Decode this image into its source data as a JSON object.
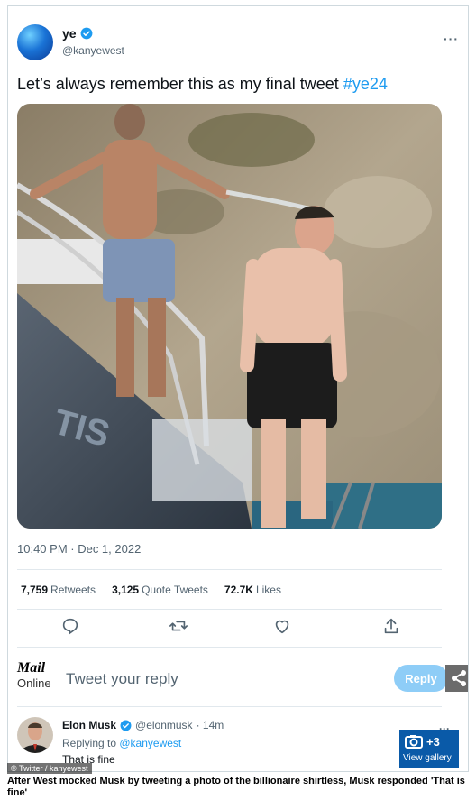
{
  "tweet": {
    "display_name": "ye",
    "handle": "@kanyewest",
    "text_main": "Let’s always remember this as my final tweet ",
    "hashtag": "#ye24",
    "timestamp": "10:40 PM · Dec 1, 2022",
    "more_icon": "more-dots-icon"
  },
  "stats": {
    "retweets_count": "7,759",
    "retweets_label": "Retweets",
    "quotes_count": "3,125",
    "quotes_label": "Quote Tweets",
    "likes_count": "72.7K",
    "likes_label": "Likes"
  },
  "actions": [
    "reply-icon",
    "retweet-icon",
    "like-icon",
    "share-icon"
  ],
  "reply_box": {
    "logo_top": "Mail",
    "logo_bottom": "Online",
    "placeholder": "Tweet your reply",
    "button_label": "Reply"
  },
  "reply": {
    "name": "Elon Musk",
    "handle": "@elonmusk",
    "time": "· 14m",
    "replying_prefix": "Replying to ",
    "replying_to": "@kanyewest",
    "text": "That is fine"
  },
  "gallery": {
    "count": "+3",
    "label": "View gallery"
  },
  "credit": "© Twitter / kanyewest",
  "caption": "After West mocked Musk by tweeting a photo of the billionaire shirtless, Musk responded 'That is fine'",
  "colors": {
    "accent": "#1d9bf0",
    "reply_button": "#8ecdf7",
    "gallery_button": "#0a5aa8"
  }
}
